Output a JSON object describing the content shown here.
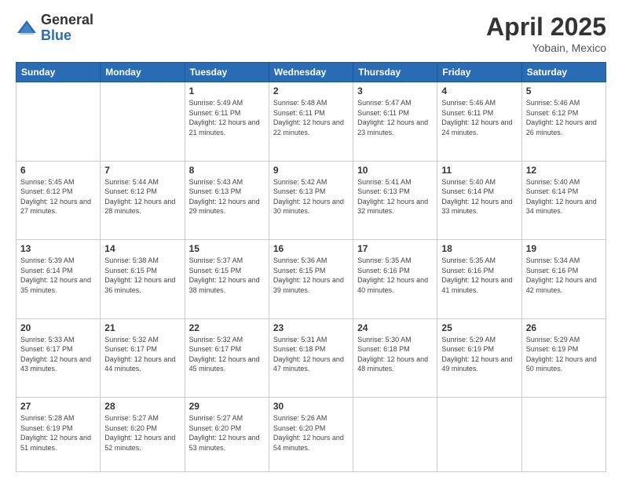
{
  "header": {
    "logo_general": "General",
    "logo_blue": "Blue",
    "title": "April 2025",
    "location": "Yobain, Mexico"
  },
  "weekdays": [
    "Sunday",
    "Monday",
    "Tuesday",
    "Wednesday",
    "Thursday",
    "Friday",
    "Saturday"
  ],
  "weeks": [
    [
      {
        "day": "",
        "info": ""
      },
      {
        "day": "",
        "info": ""
      },
      {
        "day": "1",
        "info": "Sunrise: 5:49 AM\nSunset: 6:11 PM\nDaylight: 12 hours and 21 minutes."
      },
      {
        "day": "2",
        "info": "Sunrise: 5:48 AM\nSunset: 6:11 PM\nDaylight: 12 hours and 22 minutes."
      },
      {
        "day": "3",
        "info": "Sunrise: 5:47 AM\nSunset: 6:11 PM\nDaylight: 12 hours and 23 minutes."
      },
      {
        "day": "4",
        "info": "Sunrise: 5:46 AM\nSunset: 6:11 PM\nDaylight: 12 hours and 24 minutes."
      },
      {
        "day": "5",
        "info": "Sunrise: 5:46 AM\nSunset: 6:12 PM\nDaylight: 12 hours and 26 minutes."
      }
    ],
    [
      {
        "day": "6",
        "info": "Sunrise: 5:45 AM\nSunset: 6:12 PM\nDaylight: 12 hours and 27 minutes."
      },
      {
        "day": "7",
        "info": "Sunrise: 5:44 AM\nSunset: 6:12 PM\nDaylight: 12 hours and 28 minutes."
      },
      {
        "day": "8",
        "info": "Sunrise: 5:43 AM\nSunset: 6:13 PM\nDaylight: 12 hours and 29 minutes."
      },
      {
        "day": "9",
        "info": "Sunrise: 5:42 AM\nSunset: 6:13 PM\nDaylight: 12 hours and 30 minutes."
      },
      {
        "day": "10",
        "info": "Sunrise: 5:41 AM\nSunset: 6:13 PM\nDaylight: 12 hours and 32 minutes."
      },
      {
        "day": "11",
        "info": "Sunrise: 5:40 AM\nSunset: 6:14 PM\nDaylight: 12 hours and 33 minutes."
      },
      {
        "day": "12",
        "info": "Sunrise: 5:40 AM\nSunset: 6:14 PM\nDaylight: 12 hours and 34 minutes."
      }
    ],
    [
      {
        "day": "13",
        "info": "Sunrise: 5:39 AM\nSunset: 6:14 PM\nDaylight: 12 hours and 35 minutes."
      },
      {
        "day": "14",
        "info": "Sunrise: 5:38 AM\nSunset: 6:15 PM\nDaylight: 12 hours and 36 minutes."
      },
      {
        "day": "15",
        "info": "Sunrise: 5:37 AM\nSunset: 6:15 PM\nDaylight: 12 hours and 38 minutes."
      },
      {
        "day": "16",
        "info": "Sunrise: 5:36 AM\nSunset: 6:15 PM\nDaylight: 12 hours and 39 minutes."
      },
      {
        "day": "17",
        "info": "Sunrise: 5:35 AM\nSunset: 6:16 PM\nDaylight: 12 hours and 40 minutes."
      },
      {
        "day": "18",
        "info": "Sunrise: 5:35 AM\nSunset: 6:16 PM\nDaylight: 12 hours and 41 minutes."
      },
      {
        "day": "19",
        "info": "Sunrise: 5:34 AM\nSunset: 6:16 PM\nDaylight: 12 hours and 42 minutes."
      }
    ],
    [
      {
        "day": "20",
        "info": "Sunrise: 5:33 AM\nSunset: 6:17 PM\nDaylight: 12 hours and 43 minutes."
      },
      {
        "day": "21",
        "info": "Sunrise: 5:32 AM\nSunset: 6:17 PM\nDaylight: 12 hours and 44 minutes."
      },
      {
        "day": "22",
        "info": "Sunrise: 5:32 AM\nSunset: 6:17 PM\nDaylight: 12 hours and 45 minutes."
      },
      {
        "day": "23",
        "info": "Sunrise: 5:31 AM\nSunset: 6:18 PM\nDaylight: 12 hours and 47 minutes."
      },
      {
        "day": "24",
        "info": "Sunrise: 5:30 AM\nSunset: 6:18 PM\nDaylight: 12 hours and 48 minutes."
      },
      {
        "day": "25",
        "info": "Sunrise: 5:29 AM\nSunset: 6:19 PM\nDaylight: 12 hours and 49 minutes."
      },
      {
        "day": "26",
        "info": "Sunrise: 5:29 AM\nSunset: 6:19 PM\nDaylight: 12 hours and 50 minutes."
      }
    ],
    [
      {
        "day": "27",
        "info": "Sunrise: 5:28 AM\nSunset: 6:19 PM\nDaylight: 12 hours and 51 minutes."
      },
      {
        "day": "28",
        "info": "Sunrise: 5:27 AM\nSunset: 6:20 PM\nDaylight: 12 hours and 52 minutes."
      },
      {
        "day": "29",
        "info": "Sunrise: 5:27 AM\nSunset: 6:20 PM\nDaylight: 12 hours and 53 minutes."
      },
      {
        "day": "30",
        "info": "Sunrise: 5:26 AM\nSunset: 6:20 PM\nDaylight: 12 hours and 54 minutes."
      },
      {
        "day": "",
        "info": ""
      },
      {
        "day": "",
        "info": ""
      },
      {
        "day": "",
        "info": ""
      }
    ]
  ]
}
